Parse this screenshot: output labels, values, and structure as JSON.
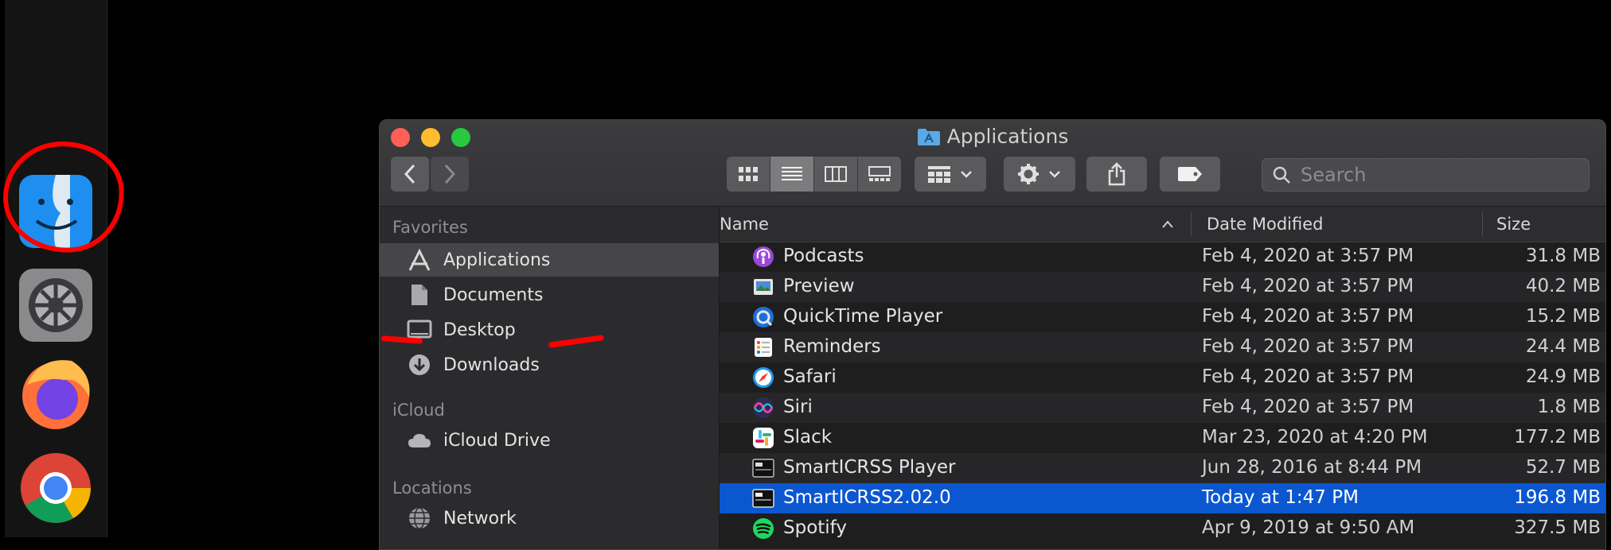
{
  "window": {
    "title": "Applications"
  },
  "toolbar": {
    "search_placeholder": "Search"
  },
  "sidebar": {
    "sections": [
      {
        "heading": "Favorites",
        "items": [
          "Applications",
          "Documents",
          "Desktop",
          "Downloads"
        ]
      },
      {
        "heading": "iCloud",
        "items": [
          "iCloud Drive"
        ]
      },
      {
        "heading": "Locations",
        "items": [
          "Network"
        ]
      }
    ]
  },
  "list": {
    "columns": [
      "Name",
      "Date Modified",
      "Size"
    ],
    "rows": [
      {
        "name": "Podcasts",
        "date": "Feb 4, 2020 at 3:57 PM",
        "size": "31.8 MB"
      },
      {
        "name": "Preview",
        "date": "Feb 4, 2020 at 3:57 PM",
        "size": "40.2 MB"
      },
      {
        "name": "QuickTime Player",
        "date": "Feb 4, 2020 at 3:57 PM",
        "size": "15.2 MB"
      },
      {
        "name": "Reminders",
        "date": "Feb 4, 2020 at 3:57 PM",
        "size": "24.4 MB"
      },
      {
        "name": "Safari",
        "date": "Feb 4, 2020 at 3:57 PM",
        "size": "24.9 MB"
      },
      {
        "name": "Siri",
        "date": "Feb 4, 2020 at 3:57 PM",
        "size": "1.8 MB"
      },
      {
        "name": "Slack",
        "date": "Mar 23, 2020 at 4:20 PM",
        "size": "177.2 MB"
      },
      {
        "name": "SmartICRSS Player",
        "date": "Jun 28, 2016 at 8:44 PM",
        "size": "52.7 MB"
      },
      {
        "name": "SmartICRSS2.02.0",
        "date": "Today at 1:47 PM",
        "size": "196.8 MB"
      },
      {
        "name": "Spotify",
        "date": "Apr 9, 2019 at 9:50 AM",
        "size": "327.5 MB"
      }
    ]
  },
  "colors": {
    "selection": "#0b57d0",
    "annotation": "#ff0000"
  }
}
